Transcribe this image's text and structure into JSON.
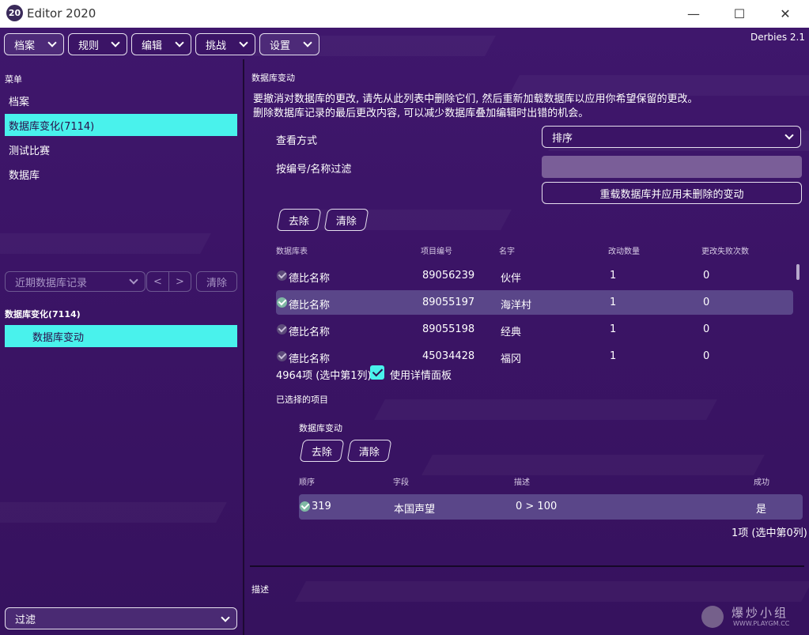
{
  "window": {
    "app_icon_text": "20",
    "title": "Editor 2020",
    "minimize": "—",
    "maximize": "☐",
    "close": "✕"
  },
  "toolbar": {
    "items": [
      {
        "label": "档案"
      },
      {
        "label": "规则"
      },
      {
        "label": "编辑"
      },
      {
        "label": "挑战"
      },
      {
        "label": "设置"
      }
    ],
    "version": "Derbies 2.1"
  },
  "sidebar": {
    "menu_label": "菜单",
    "items": [
      {
        "label": "档案"
      },
      {
        "label": "数据库变化(7114)"
      },
      {
        "label": "测试比赛"
      },
      {
        "label": "数据库"
      }
    ],
    "history_placeholder": "近期数据库记录",
    "prev": "<",
    "next": ">",
    "clear_label": "清除",
    "changes_header": "数据库变化(7114)",
    "changes_item": "数据库变动",
    "filter_label": "过滤"
  },
  "main": {
    "title": "数据库变动",
    "notice_line1": "要撤消对数据库的更改, 请先从此列表中删除它们, 然后重新加载数据库以应用你希望保留的更改。",
    "notice_line2": "删除数据库记录的最后更改内容, 可以减少数据库叠加编辑时出错的机会。",
    "view_label": "查看方式",
    "view_value": "排序",
    "filter_label": "按编号/名称过滤",
    "reload_button": "重载数据库并应用未删除的变动",
    "remove_button": "去除",
    "clear_button": "清除",
    "table": {
      "headers": [
        "数据库表",
        "项目编号",
        "名字",
        "改动数量",
        "更改失败次数"
      ],
      "rows": [
        {
          "table": "德比名称",
          "id": "89056239",
          "name": "伙伴",
          "changes": "1",
          "failures": "0",
          "checked": false
        },
        {
          "table": "德比名称",
          "id": "89055197",
          "name": "海洋村",
          "changes": "1",
          "failures": "0",
          "checked": true
        },
        {
          "table": "德比名称",
          "id": "89055198",
          "name": "经典",
          "changes": "1",
          "failures": "0",
          "checked": false
        },
        {
          "table": "德比名称",
          "id": "45034428",
          "name": "福冈",
          "changes": "1",
          "failures": "0",
          "checked": false
        }
      ]
    },
    "count_text": "4964项 (选中第1列)",
    "use_panel_label": "使用详情面板",
    "selected_items_label": "已选择的项目",
    "detail": {
      "title": "数据库变动",
      "remove_button": "去除",
      "clear_button": "清除",
      "headers": [
        "顺序",
        "字段",
        "描述",
        "成功"
      ],
      "row": {
        "order": "319",
        "field": "本国声望",
        "desc": "0 > 100",
        "success": "是"
      },
      "count_text": "1项 (选中第0列)"
    },
    "description_label": "描述"
  },
  "watermark": {
    "text": "爆炒小组",
    "sub": "WWW.PLAYGM.CC"
  }
}
